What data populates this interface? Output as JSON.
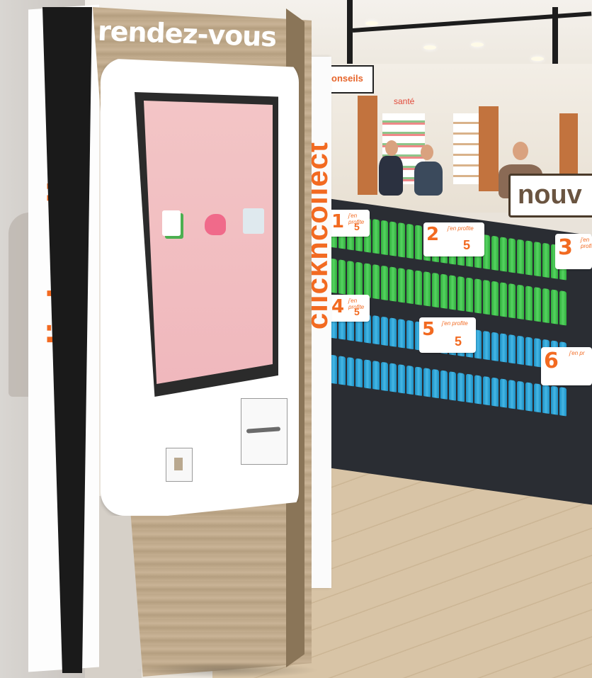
{
  "kiosk": {
    "title": "rendez-vous",
    "side_text": "clickncollect",
    "screen_options": [
      {
        "label": "",
        "icon": "documents-icon"
      },
      {
        "label": "",
        "icon": "scooter-icon"
      },
      {
        "label": "",
        "icon": "map-icon"
      }
    ]
  },
  "column": {
    "text": "clickncollect"
  },
  "store": {
    "signs": {
      "conseils": "onseils",
      "sante": "santé",
      "nouv": "nouv"
    },
    "price_cards": [
      {
        "num": "1",
        "label": "j'en profite",
        "price": "5"
      },
      {
        "num": "2",
        "label": "j'en profite",
        "price": "5"
      },
      {
        "num": "3",
        "label": "j'en profite",
        "price": ""
      },
      {
        "num": "4",
        "label": "j'en profite",
        "price": "5"
      },
      {
        "num": "5",
        "label": "j'en profite",
        "price": "5"
      },
      {
        "num": "6",
        "label": "j'en pr",
        "price": ""
      }
    ]
  },
  "colors": {
    "brand_orange": "#f26a21",
    "screen_pink": "#f3c5c6",
    "wood": "#c4ae90",
    "bottle_green": "#3fbf4a",
    "bottle_blue": "#2ea6d8"
  }
}
